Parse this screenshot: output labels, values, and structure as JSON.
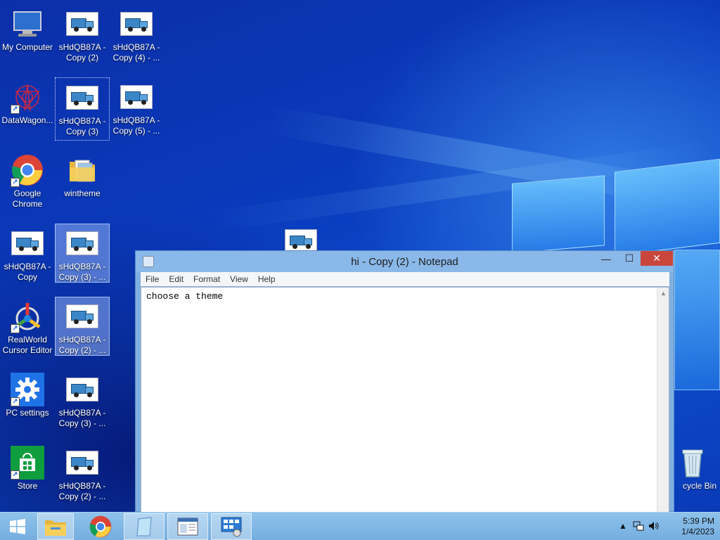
{
  "desktop": {
    "icons": [
      {
        "label": "My Computer",
        "icon": "computer-icon"
      },
      {
        "label": "sHdQB87A - Copy (2)",
        "icon": "image-file-icon"
      },
      {
        "label": "sHdQB87A - Copy (4) - ...",
        "icon": "image-file-icon"
      },
      {
        "label": "DataWagon...",
        "icon": "datawagon-icon"
      },
      {
        "label": "sHdQB87A - Copy (3)",
        "icon": "image-file-icon"
      },
      {
        "label": "sHdQB87A - Copy (5) - ...",
        "icon": "image-file-icon"
      },
      {
        "label": "Google Chrome",
        "icon": "chrome-icon"
      },
      {
        "label": "wintheme",
        "icon": "folder-icon"
      },
      {
        "label": "sHdQB87A - Copy",
        "icon": "image-file-icon"
      },
      {
        "label": "sHdQB87A - Copy (3) - ...",
        "icon": "image-file-icon"
      },
      {
        "label": "RealWorld Cursor Editor",
        "icon": "cursor-editor-icon"
      },
      {
        "label": "sHdQB87A - Copy (2) - ...",
        "icon": "image-file-icon"
      },
      {
        "label": "PC settings",
        "icon": "gear-icon"
      },
      {
        "label": "sHdQB87A - Copy (3) - ...",
        "icon": "image-file-icon"
      },
      {
        "label": "Store",
        "icon": "store-icon"
      },
      {
        "label": "sHdQB87A - Copy (2) - ...",
        "icon": "image-file-icon"
      },
      {
        "label": "cycle Bin",
        "icon": "recycle-bin-icon"
      }
    ]
  },
  "notepad": {
    "title": "hi - Copy (2) - Notepad",
    "menu": [
      "File",
      "Edit",
      "Format",
      "View",
      "Help"
    ],
    "content": "choose a theme",
    "buttons": {
      "minimize": "—",
      "maximize": "☐",
      "close": "✕"
    }
  },
  "taskbar": {
    "items": [
      "start-icon",
      "file-explorer-icon",
      "chrome-icon",
      "notepad-icon",
      "window-app-icon",
      "control-panel-icon"
    ],
    "clock_time": "5:39 PM",
    "clock_date": "1/4/2023",
    "tray_icons": [
      "show-hidden-icons-icon",
      "network-icon",
      "volume-icon"
    ]
  }
}
